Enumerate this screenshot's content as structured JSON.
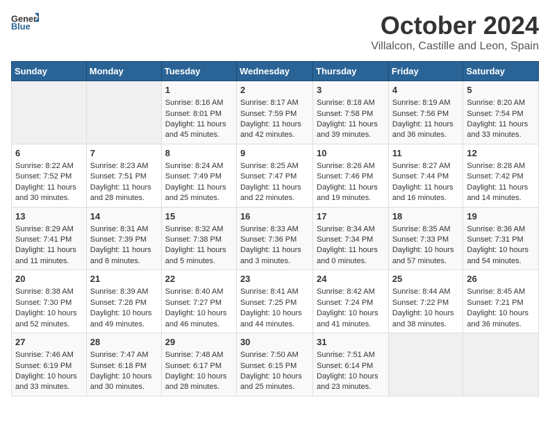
{
  "header": {
    "logo_general": "General",
    "logo_blue": "Blue",
    "month_title": "October 2024",
    "location": "Villalcon, Castille and Leon, Spain"
  },
  "weekdays": [
    "Sunday",
    "Monday",
    "Tuesday",
    "Wednesday",
    "Thursday",
    "Friday",
    "Saturday"
  ],
  "weeks": [
    [
      {
        "day": "",
        "info": ""
      },
      {
        "day": "",
        "info": ""
      },
      {
        "day": "1",
        "info": "Sunrise: 8:16 AM\nSunset: 8:01 PM\nDaylight: 11 hours and 45 minutes."
      },
      {
        "day": "2",
        "info": "Sunrise: 8:17 AM\nSunset: 7:59 PM\nDaylight: 11 hours and 42 minutes."
      },
      {
        "day": "3",
        "info": "Sunrise: 8:18 AM\nSunset: 7:58 PM\nDaylight: 11 hours and 39 minutes."
      },
      {
        "day": "4",
        "info": "Sunrise: 8:19 AM\nSunset: 7:56 PM\nDaylight: 11 hours and 36 minutes."
      },
      {
        "day": "5",
        "info": "Sunrise: 8:20 AM\nSunset: 7:54 PM\nDaylight: 11 hours and 33 minutes."
      }
    ],
    [
      {
        "day": "6",
        "info": "Sunrise: 8:22 AM\nSunset: 7:52 PM\nDaylight: 11 hours and 30 minutes."
      },
      {
        "day": "7",
        "info": "Sunrise: 8:23 AM\nSunset: 7:51 PM\nDaylight: 11 hours and 28 minutes."
      },
      {
        "day": "8",
        "info": "Sunrise: 8:24 AM\nSunset: 7:49 PM\nDaylight: 11 hours and 25 minutes."
      },
      {
        "day": "9",
        "info": "Sunrise: 8:25 AM\nSunset: 7:47 PM\nDaylight: 11 hours and 22 minutes."
      },
      {
        "day": "10",
        "info": "Sunrise: 8:26 AM\nSunset: 7:46 PM\nDaylight: 11 hours and 19 minutes."
      },
      {
        "day": "11",
        "info": "Sunrise: 8:27 AM\nSunset: 7:44 PM\nDaylight: 11 hours and 16 minutes."
      },
      {
        "day": "12",
        "info": "Sunrise: 8:28 AM\nSunset: 7:42 PM\nDaylight: 11 hours and 14 minutes."
      }
    ],
    [
      {
        "day": "13",
        "info": "Sunrise: 8:29 AM\nSunset: 7:41 PM\nDaylight: 11 hours and 11 minutes."
      },
      {
        "day": "14",
        "info": "Sunrise: 8:31 AM\nSunset: 7:39 PM\nDaylight: 11 hours and 8 minutes."
      },
      {
        "day": "15",
        "info": "Sunrise: 8:32 AM\nSunset: 7:38 PM\nDaylight: 11 hours and 5 minutes."
      },
      {
        "day": "16",
        "info": "Sunrise: 8:33 AM\nSunset: 7:36 PM\nDaylight: 11 hours and 3 minutes."
      },
      {
        "day": "17",
        "info": "Sunrise: 8:34 AM\nSunset: 7:34 PM\nDaylight: 11 hours and 0 minutes."
      },
      {
        "day": "18",
        "info": "Sunrise: 8:35 AM\nSunset: 7:33 PM\nDaylight: 10 hours and 57 minutes."
      },
      {
        "day": "19",
        "info": "Sunrise: 8:36 AM\nSunset: 7:31 PM\nDaylight: 10 hours and 54 minutes."
      }
    ],
    [
      {
        "day": "20",
        "info": "Sunrise: 8:38 AM\nSunset: 7:30 PM\nDaylight: 10 hours and 52 minutes."
      },
      {
        "day": "21",
        "info": "Sunrise: 8:39 AM\nSunset: 7:28 PM\nDaylight: 10 hours and 49 minutes."
      },
      {
        "day": "22",
        "info": "Sunrise: 8:40 AM\nSunset: 7:27 PM\nDaylight: 10 hours and 46 minutes."
      },
      {
        "day": "23",
        "info": "Sunrise: 8:41 AM\nSunset: 7:25 PM\nDaylight: 10 hours and 44 minutes."
      },
      {
        "day": "24",
        "info": "Sunrise: 8:42 AM\nSunset: 7:24 PM\nDaylight: 10 hours and 41 minutes."
      },
      {
        "day": "25",
        "info": "Sunrise: 8:44 AM\nSunset: 7:22 PM\nDaylight: 10 hours and 38 minutes."
      },
      {
        "day": "26",
        "info": "Sunrise: 8:45 AM\nSunset: 7:21 PM\nDaylight: 10 hours and 36 minutes."
      }
    ],
    [
      {
        "day": "27",
        "info": "Sunrise: 7:46 AM\nSunset: 6:19 PM\nDaylight: 10 hours and 33 minutes."
      },
      {
        "day": "28",
        "info": "Sunrise: 7:47 AM\nSunset: 6:18 PM\nDaylight: 10 hours and 30 minutes."
      },
      {
        "day": "29",
        "info": "Sunrise: 7:48 AM\nSunset: 6:17 PM\nDaylight: 10 hours and 28 minutes."
      },
      {
        "day": "30",
        "info": "Sunrise: 7:50 AM\nSunset: 6:15 PM\nDaylight: 10 hours and 25 minutes."
      },
      {
        "day": "31",
        "info": "Sunrise: 7:51 AM\nSunset: 6:14 PM\nDaylight: 10 hours and 23 minutes."
      },
      {
        "day": "",
        "info": ""
      },
      {
        "day": "",
        "info": ""
      }
    ]
  ]
}
